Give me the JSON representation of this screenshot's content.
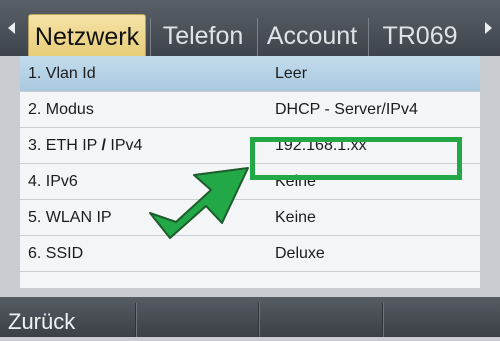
{
  "tabs": [
    {
      "label": "Netzwerk",
      "active": true
    },
    {
      "label": "Telefon",
      "active": false
    },
    {
      "label": "Account",
      "active": false
    },
    {
      "label": "TR069",
      "active": false
    }
  ],
  "rows": [
    {
      "label": "1. Vlan Id",
      "value": "Leer",
      "selected": true
    },
    {
      "label": "2. Modus",
      "value": "DHCP - Server/IPv4",
      "selected": false
    },
    {
      "label_parts": [
        "3. ETH IP ",
        "/",
        " IPv4"
      ],
      "value": "192.168.1.xx",
      "selected": false
    },
    {
      "label": "4. IPv6",
      "value": "Keine",
      "selected": false
    },
    {
      "label": "5. WLAN IP",
      "value": "Keine",
      "selected": false
    },
    {
      "label": "6. SSID",
      "value": "Deluxe",
      "selected": false
    }
  ],
  "softkeys": [
    {
      "label": "Zurück"
    },
    {
      "label": ""
    },
    {
      "label": ""
    },
    {
      "label": ""
    }
  ],
  "colors": {
    "annotation_green": "#22a846",
    "active_tab": "#f0dc96",
    "selected_row": "#b8d4e6"
  },
  "icons": {
    "tab_left": "chevron-left-icon",
    "tab_right": "chevron-right-icon",
    "annotation": "arrow-annotation-icon"
  }
}
